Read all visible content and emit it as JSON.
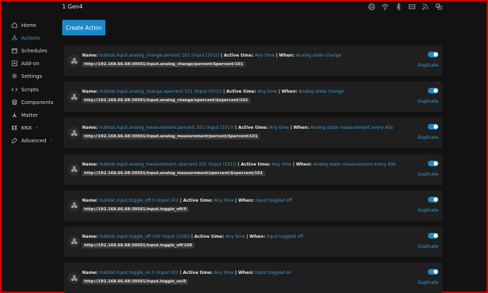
{
  "header": {
    "device_name": "1 Gen4",
    "status_icons": [
      "cloud-icon",
      "wifi-icon",
      "bluetooth-icon",
      "ethernet-icon",
      "rss-icon",
      "restart-icon"
    ]
  },
  "sidebar": {
    "items": [
      {
        "label": "Home",
        "icon": "home-icon",
        "active": false,
        "chevron": false
      },
      {
        "label": "Actions",
        "icon": "actions-icon",
        "active": true,
        "chevron": false
      },
      {
        "label": "Schedules",
        "icon": "calendar-icon",
        "active": false,
        "chevron": false
      },
      {
        "label": "Add-on",
        "icon": "addon-icon",
        "active": false,
        "chevron": false
      },
      {
        "label": "Settings",
        "icon": "gear-icon",
        "active": false,
        "chevron": false
      },
      {
        "label": "Scripts",
        "icon": "code-icon",
        "active": false,
        "chevron": false
      },
      {
        "label": "Components",
        "icon": "components-icon",
        "active": false,
        "chevron": false
      },
      {
        "label": "Matter",
        "icon": "matter-icon",
        "active": false,
        "chevron": false
      },
      {
        "label": "KNX",
        "icon": "knx-icon",
        "active": false,
        "chevron": true
      },
      {
        "label": "Advanced",
        "icon": "advanced-icon",
        "active": false,
        "chevron": true
      }
    ]
  },
  "main": {
    "create_button": "Create Action",
    "labels": {
      "name": "Name:",
      "active_time": "Active time:",
      "when": "When:",
      "sep": "|",
      "duplicate": "Duplicate"
    },
    "actions": [
      {
        "name": "hubitat.input.analog_change.percent.101 (Input (101))",
        "active_time": "Any time",
        "when": "Analog state change",
        "url": "http://192.168.66.68:39501/input.analog_change/percent/$percent/101",
        "enabled": true
      },
      {
        "name": "hubitat.input.analog_change.xpercent.101 (Input (101))",
        "active_time": "Any time",
        "when": "Analog state change",
        "url": "http://192.168.66.68:39501/input.analog_change/xpercent/$xpercent/101",
        "enabled": true
      },
      {
        "name": "hubitat.input.analog_measurement.percent.101 (Input (101))",
        "active_time": "Any time",
        "when": "Analog state measurement every 60s",
        "url": "http://192.168.66.68:39501/input.analog_measurement/percent/$percent/101",
        "enabled": true
      },
      {
        "name": "hubitat.input.analog_measurement.xpercent.101 (Input (101))",
        "active_time": "Any time",
        "when": "Analog state measurement every 60s",
        "url": "http://192.168.66.68:39501/input.analog_measurement/xpercent/$xpercent/101",
        "enabled": true
      },
      {
        "name": "hubitat.input.toggle_off.0 (Input (0))",
        "active_time": "Any time",
        "when": "Input toggled off",
        "url": "http://192.168.66.68:39501/input.toggle_off/0",
        "enabled": true
      },
      {
        "name": "hubitat.input.toggle_off.100 (Input (100))",
        "active_time": "Any time",
        "when": "Input toggled off",
        "url": "http://192.168.66.68:39501/input.toggle_off/100",
        "enabled": true
      },
      {
        "name": "hubitat.input.toggle_on.0 (Input (0))",
        "active_time": "Any time",
        "when": "Input toggled on",
        "url": "http://192.168.66.68:39501/input.toggle_on/0",
        "enabled": true
      }
    ]
  },
  "colors": {
    "accent": "#1e88c7",
    "link": "#3d9fd6",
    "background": "#121212",
    "card": "#1f1f1f",
    "frame": "#d20000"
  }
}
